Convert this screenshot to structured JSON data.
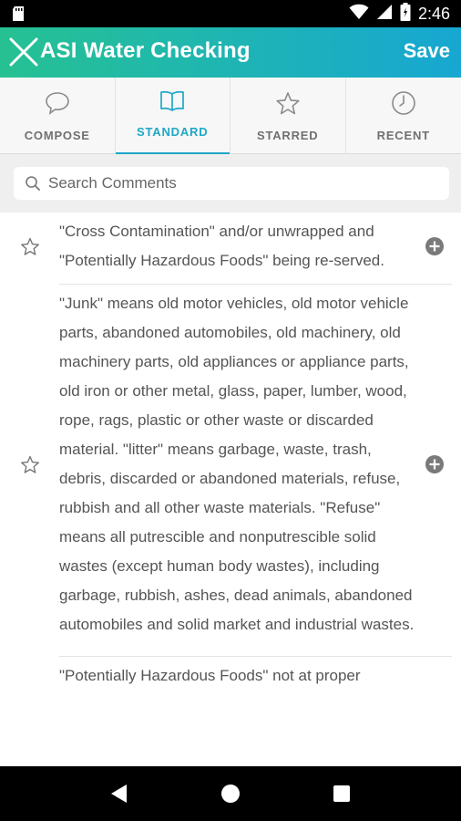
{
  "status_bar": {
    "time": "2:46"
  },
  "header": {
    "title": "ASI Water Checking",
    "save_label": "Save"
  },
  "tabs": [
    {
      "label": "COMPOSE",
      "icon": "speech-bubble-icon",
      "active": false
    },
    {
      "label": "STANDARD",
      "icon": "open-book-icon",
      "active": true
    },
    {
      "label": "STARRED",
      "icon": "star-icon",
      "active": false
    },
    {
      "label": "RECENT",
      "icon": "clock-icon",
      "active": false
    }
  ],
  "search": {
    "placeholder": "Search Comments"
  },
  "comments": [
    {
      "text": "\"Cross Contamination\" and/or unwrapped and \"Potentially Hazardous Foods\" being re-served."
    },
    {
      "text": "\"Junk\" means old motor vehicles, old motor vehicle parts, abandoned automobiles, old machinery, old machinery parts, old appliances or appliance parts, old iron or other metal, glass, paper, lumber, wood, rope, rags, plastic or other waste or discarded material. \"litter\" means garbage, waste, trash, debris, discarded or abandoned materials, refuse, rubbish and all other waste materials. \"Refuse\" means all putrescible and nonputrescible solid wastes (except human body wastes), including garbage, rubbish, ashes, dead animals, abandoned automobiles and solid market and industrial wastes."
    },
    {
      "text": "\"Potentially Hazardous Foods\" not at proper"
    }
  ],
  "colors": {
    "accent": "#1ea7c7",
    "header_start": "#26c192",
    "header_end": "#17a7d2"
  }
}
